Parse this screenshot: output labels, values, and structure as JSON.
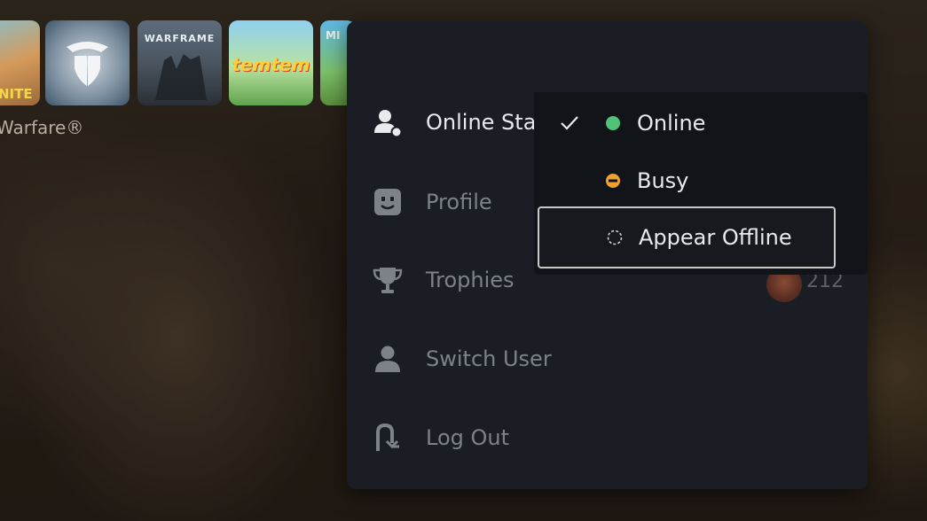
{
  "game_tiles": [
    {
      "name": "fortnite",
      "label": "NITE"
    },
    {
      "name": "destiny",
      "label": ""
    },
    {
      "name": "warframe",
      "label": "WARFRAME"
    },
    {
      "name": "temtem",
      "label": "temtem"
    },
    {
      "name": "minecraft",
      "label": "MI"
    }
  ],
  "background_title": "Warfare®",
  "menu": {
    "items": [
      {
        "id": "online-status",
        "label": "Online Sta",
        "icon": "user-status-icon"
      },
      {
        "id": "profile",
        "label": "Profile",
        "icon": "face-icon"
      },
      {
        "id": "trophies",
        "label": "Trophies",
        "icon": "trophy-icon"
      },
      {
        "id": "switch-user",
        "label": "Switch User",
        "icon": "user-icon"
      },
      {
        "id": "log-out",
        "label": "Log Out",
        "icon": "logout-icon"
      }
    ],
    "trophy_count": "212"
  },
  "status_options": [
    {
      "label": "Online",
      "selected": true,
      "color": "#4fc37a",
      "icon": "online-dot-icon"
    },
    {
      "label": "Busy",
      "selected": false,
      "color": "#f0a030",
      "icon": "busy-dot-icon"
    },
    {
      "label": "Appear Offline",
      "selected": false,
      "focused": true,
      "color": "#d0d0d0",
      "icon": "offline-dashed-circle-icon"
    }
  ],
  "colors": {
    "panel_bg": "#1a1d23",
    "submenu_bg": "#111419",
    "text_active": "#e8eaed",
    "text_dim": "#7d8289"
  }
}
